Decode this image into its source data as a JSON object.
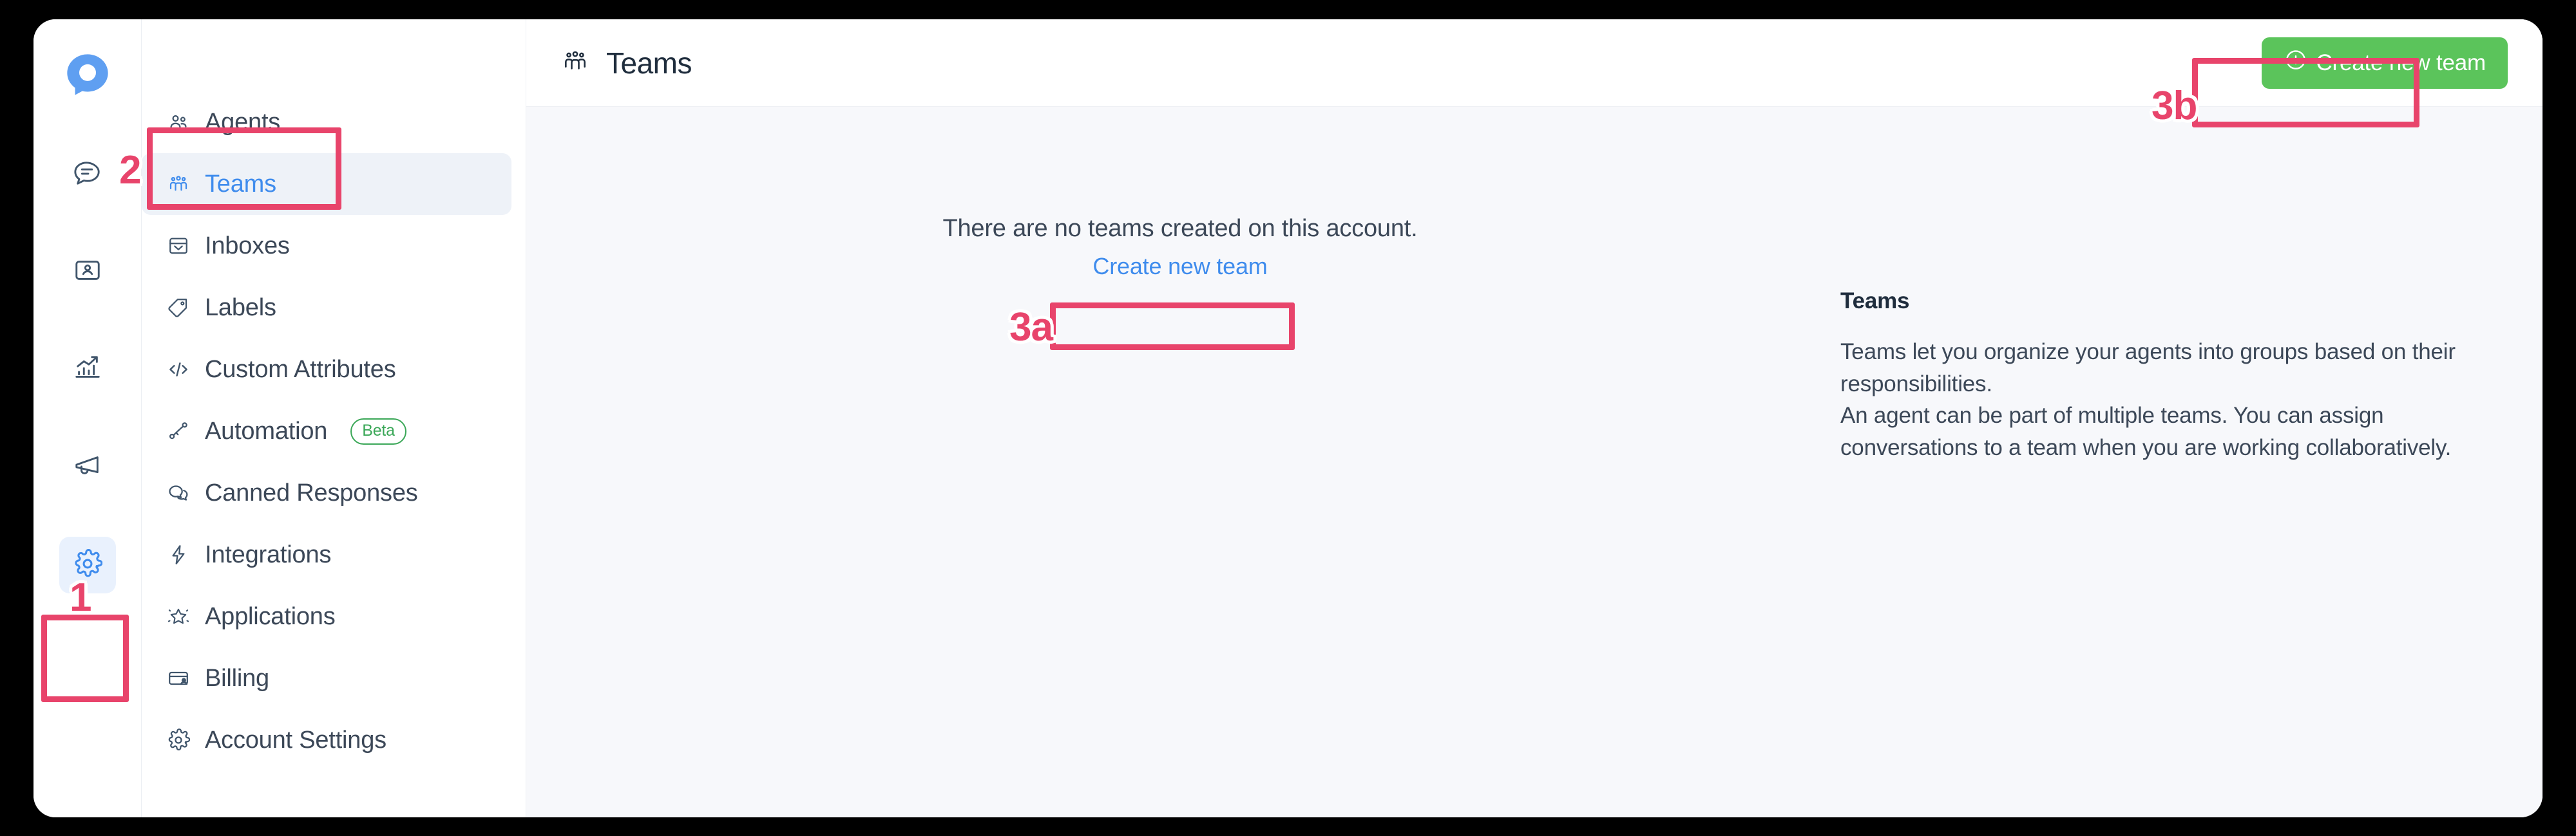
{
  "app": {
    "logo_icon": "chatwoot-logo-icon"
  },
  "icon_rail": {
    "items": [
      {
        "name": "conversations",
        "icon": "chat-bubble-icon",
        "active": false
      },
      {
        "name": "contacts",
        "icon": "contacts-card-icon",
        "active": false
      },
      {
        "name": "reports",
        "icon": "bar-chart-arrow-icon",
        "active": false
      },
      {
        "name": "campaigns",
        "icon": "megaphone-icon",
        "active": false
      },
      {
        "name": "settings",
        "icon": "gear-icon",
        "active": true
      }
    ]
  },
  "settings_menu": {
    "items": [
      {
        "label": "Agents",
        "icon": "people-icon",
        "active": false,
        "badge": ""
      },
      {
        "label": "Teams",
        "icon": "team-group-icon",
        "active": true,
        "badge": ""
      },
      {
        "label": "Inboxes",
        "icon": "inbox-tray-icon",
        "active": false,
        "badge": ""
      },
      {
        "label": "Labels",
        "icon": "tag-icon",
        "active": false,
        "badge": ""
      },
      {
        "label": "Custom Attributes",
        "icon": "code-brackets-icon",
        "active": false,
        "badge": ""
      },
      {
        "label": "Automation",
        "icon": "automation-icon",
        "active": false,
        "badge": "Beta"
      },
      {
        "label": "Canned Responses",
        "icon": "speech-bubbles-icon",
        "active": false,
        "badge": ""
      },
      {
        "label": "Integrations",
        "icon": "lightning-bolt-icon",
        "active": false,
        "badge": ""
      },
      {
        "label": "Applications",
        "icon": "star-sparkle-icon",
        "active": false,
        "badge": ""
      },
      {
        "label": "Billing",
        "icon": "credit-card-icon",
        "active": false,
        "badge": ""
      },
      {
        "label": "Account Settings",
        "icon": "gear-icon",
        "active": false,
        "badge": ""
      }
    ]
  },
  "header": {
    "title": "Teams",
    "title_icon": "team-group-icon",
    "create_button_label": "Create new team",
    "create_button_icon": "plus-circle-icon",
    "create_button_color": "#5bc45b"
  },
  "empty_state": {
    "message": "There are no teams created on this account.",
    "link_label": "Create new team",
    "link_color": "#3f8ced"
  },
  "side_info": {
    "title": "Teams",
    "paragraph_1": "Teams let you organize your agents into groups based on their responsibilities.",
    "paragraph_2": "An agent can be part of multiple teams. You can assign conversations to a team when you are working collaboratively."
  },
  "annotations": {
    "color": "#e8446b",
    "markers": [
      {
        "id": "1",
        "target": "settings-rail-icon"
      },
      {
        "id": "2",
        "target": "teams-menu-item"
      },
      {
        "id": "3a",
        "target": "empty-state-create-new-team-link"
      },
      {
        "id": "3b",
        "target": "header-create-new-team-button"
      }
    ]
  }
}
